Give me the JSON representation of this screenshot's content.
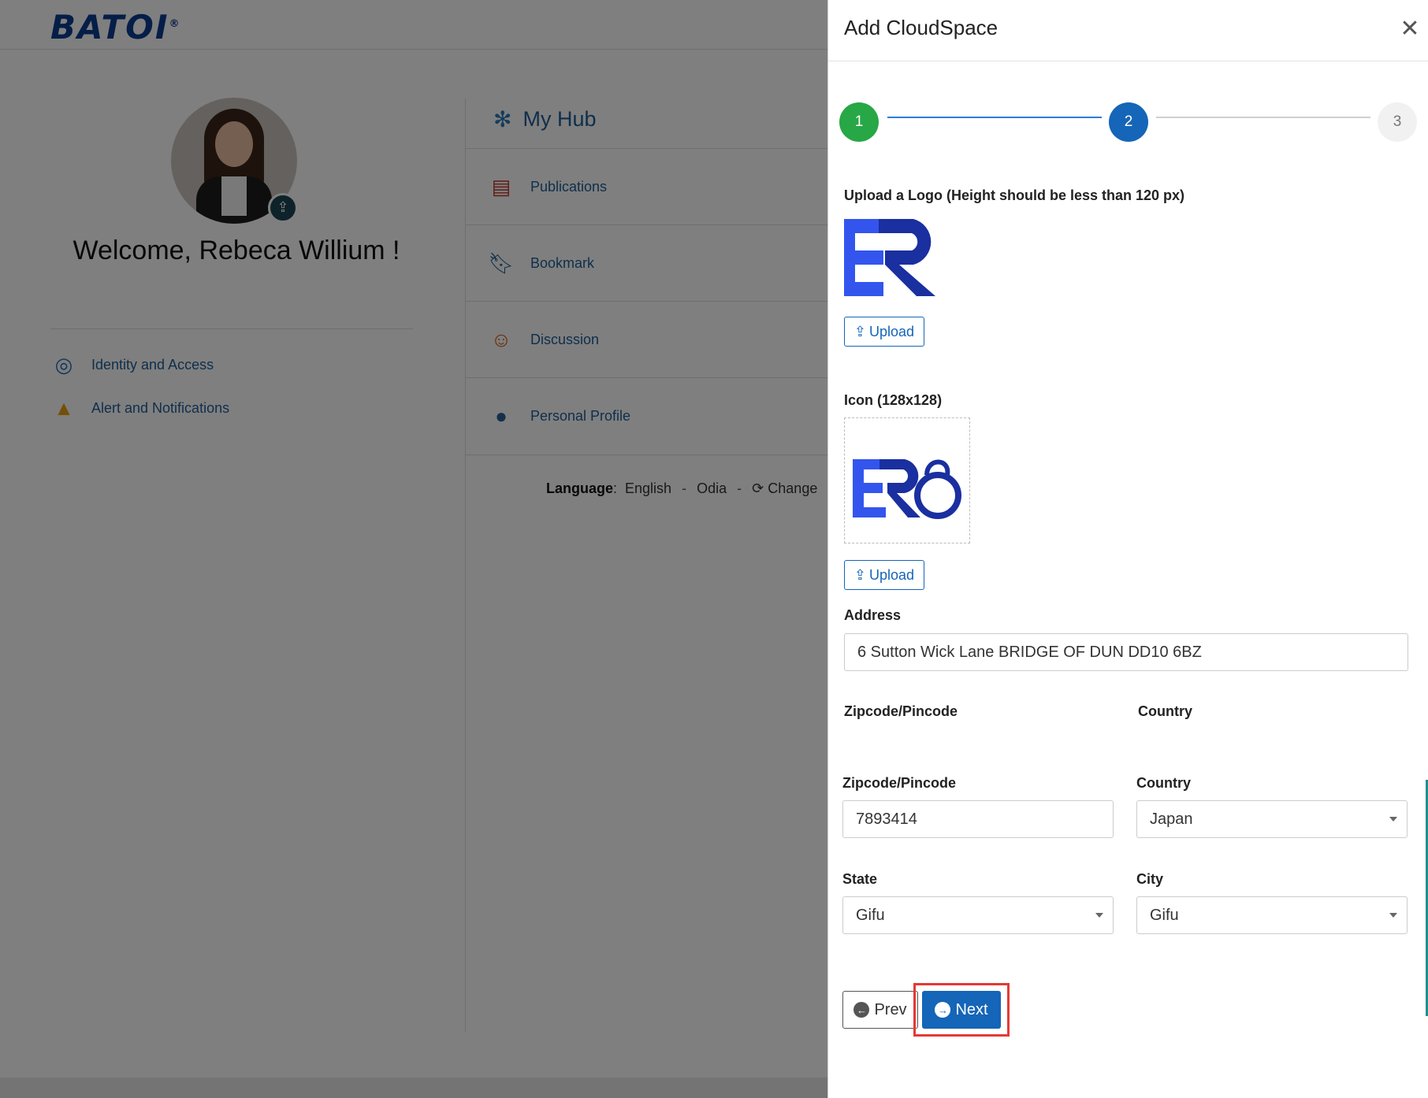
{
  "app": {
    "brand": "BATOI",
    "brand_mark": "®",
    "welcome": "Welcome, Rebeca Willium !",
    "left_links": [
      {
        "label": "Identity and Access",
        "icon": "fingerprint-shield-icon"
      },
      {
        "label": "Alert and Notifications",
        "icon": "bell-icon"
      }
    ],
    "hub": {
      "title": "My Hub",
      "items": [
        {
          "label": "Publications",
          "icon": "publications-icon"
        },
        {
          "label": "Bookmark",
          "icon": "bookmark-icon"
        },
        {
          "label": "Discussion",
          "icon": "discussion-icon"
        },
        {
          "label": "Personal Profile",
          "icon": "user-icon"
        }
      ]
    },
    "language": {
      "label": "Language",
      "options": [
        "English",
        "Odia"
      ],
      "change_label": "Change"
    }
  },
  "drawer": {
    "title": "Add CloudSpace",
    "steps": [
      "1",
      "2",
      "3"
    ],
    "current_step": 2,
    "logo_label": "Upload a Logo (Height should be less than 120 px)",
    "icon_label": "Icon (128x128)",
    "upload_label": "Upload",
    "address_label": "Address",
    "address_value": "6 Sutton Wick Lane BRIDGE OF DUN DD10 6BZ",
    "zip_header": "Zipcode/Pincode",
    "country_header": "Country",
    "zip_label": "Zipcode/Pincode",
    "zip_value": "7893414",
    "country_label": "Country",
    "country_value": "Japan",
    "state_label": "State",
    "state_value": "Gifu",
    "city_label": "City",
    "city_value": "Gifu",
    "prev_label": "Prev",
    "next_label": "Next"
  },
  "colors": {
    "primary": "#1565b8",
    "success": "#27a745",
    "highlight": "#e53935",
    "link": "#1f5e97"
  }
}
